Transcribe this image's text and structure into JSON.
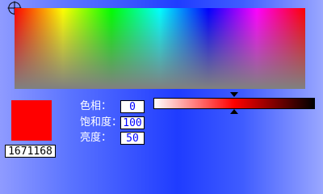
{
  "picker": {
    "crosshair_icon": "crosshair-icon",
    "selected_color_hex": "#ff0000",
    "selected_color_value": "1671168",
    "hue_label": "色相：",
    "hue_value": "0",
    "saturation_label": "饱和度：",
    "saturation_value": "100",
    "luminance_label": "亮度：",
    "luminance_value": "50",
    "luminance_position_percent": 50
  }
}
